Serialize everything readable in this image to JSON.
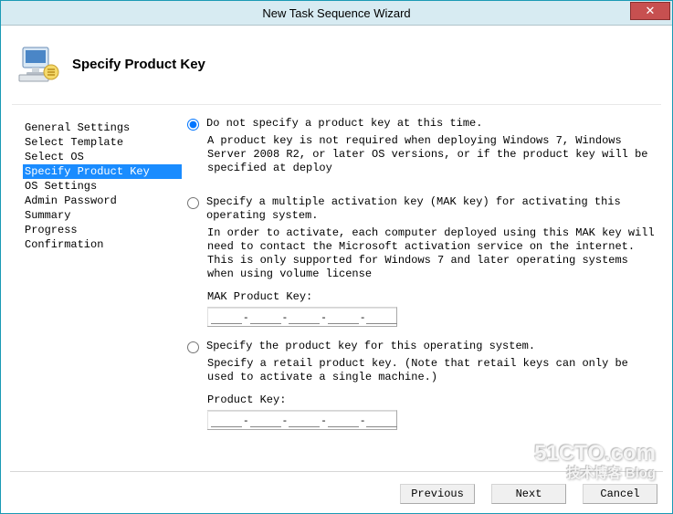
{
  "window": {
    "title": "New Task Sequence Wizard",
    "close_label": "✕"
  },
  "header": {
    "page_title": "Specify Product Key"
  },
  "sidebar": {
    "items": [
      {
        "label": "General Settings",
        "selected": false
      },
      {
        "label": "Select Template",
        "selected": false
      },
      {
        "label": "Select OS",
        "selected": false
      },
      {
        "label": "Specify Product Key",
        "selected": true
      },
      {
        "label": "OS Settings",
        "selected": false
      },
      {
        "label": "Admin Password",
        "selected": false
      },
      {
        "label": "Summary",
        "selected": false
      },
      {
        "label": "Progress",
        "selected": false
      },
      {
        "label": "Confirmation",
        "selected": false
      }
    ]
  },
  "options": {
    "opt1": {
      "label": "Do not specify a product key at this time.",
      "desc": "A product key is not required when deploying Windows 7, Windows Server 2008 R2, or later OS versions, or if the product key will be specified at deploy",
      "checked": true
    },
    "opt2": {
      "label": "Specify a multiple activation key (MAK key) for activating this operating system.",
      "desc": "In order to activate, each computer deployed using this MAK key will need to contact the Microsoft activation service on the internet.  This is only supported for Windows 7 and later operating systems when using volume license",
      "field_label": "MAK Product Key:",
      "checked": false
    },
    "opt3": {
      "label": "Specify the product key for this operating system.",
      "desc": "Specify a retail product key.  (Note that retail keys can only be used to activate a single machine.)",
      "field_label": "Product Key:",
      "checked": false
    }
  },
  "footer": {
    "previous_label": "Previous",
    "next_label": "Next",
    "cancel_label": "Cancel"
  },
  "watermark": {
    "line1": "51CTO.com",
    "line2": "技术博客 Blog"
  }
}
